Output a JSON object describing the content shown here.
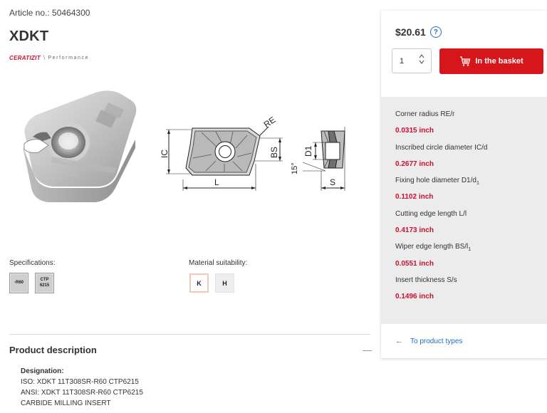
{
  "article": {
    "label": "Article no.: 50464300"
  },
  "product": {
    "title": "XDKT"
  },
  "brand": {
    "name": "CERATIZIT",
    "separator": "\\",
    "line": "Performance",
    "color": "#c8102e"
  },
  "drawing": {
    "labels": {
      "re": "RE",
      "ic": "IC",
      "bs": "BS",
      "angle": "15°",
      "l": "L",
      "d1": "D1",
      "s": "S"
    }
  },
  "specifications": {
    "label": "Specifications:",
    "badges": [
      {
        "line1": "-R60",
        "line2": ""
      },
      {
        "line1": "CTP",
        "line2": "6215"
      }
    ]
  },
  "material": {
    "label": "Material suitability:",
    "badges": [
      {
        "code": "K",
        "active": true
      },
      {
        "code": "H",
        "active": false
      }
    ]
  },
  "description": {
    "title": "Product description",
    "toggle": "—",
    "designation_label": "Designation:",
    "lines": [
      "ISO: XDKT 11T308SR-R60 CTP6215",
      "ANSI: XDKT 11T308SR-R60 CTP6215",
      "CARBIDE MILLING INSERT"
    ]
  },
  "purchase": {
    "price": "$20.61",
    "help_icon": "question-circle-icon",
    "quantity": "1",
    "basket_label": "In the basket",
    "basket_icon": "shopping-cart-icon",
    "accent_color": "#d7161b"
  },
  "properties": [
    {
      "name": "Corner radius RE/r",
      "value": "0.0315 inch"
    },
    {
      "name": "Inscribed circle diameter IC/d",
      "value": "0.2677 inch"
    },
    {
      "name_main": "Fixing hole diameter D1/d",
      "name_sub": "1",
      "value": "0.1102 inch"
    },
    {
      "name": "Cutting edge length L/l",
      "value": "0.4173 inch"
    },
    {
      "name_main": "Wiper edge length BS/l",
      "name_sub": "1",
      "value": "0.0551 inch"
    },
    {
      "name": "Insert thickness S/s",
      "value": "0.1496 inch"
    }
  ],
  "navigation": {
    "back_label": "To product types",
    "back_icon": "arrow-left-icon",
    "link_color": "#1f6fc5"
  }
}
